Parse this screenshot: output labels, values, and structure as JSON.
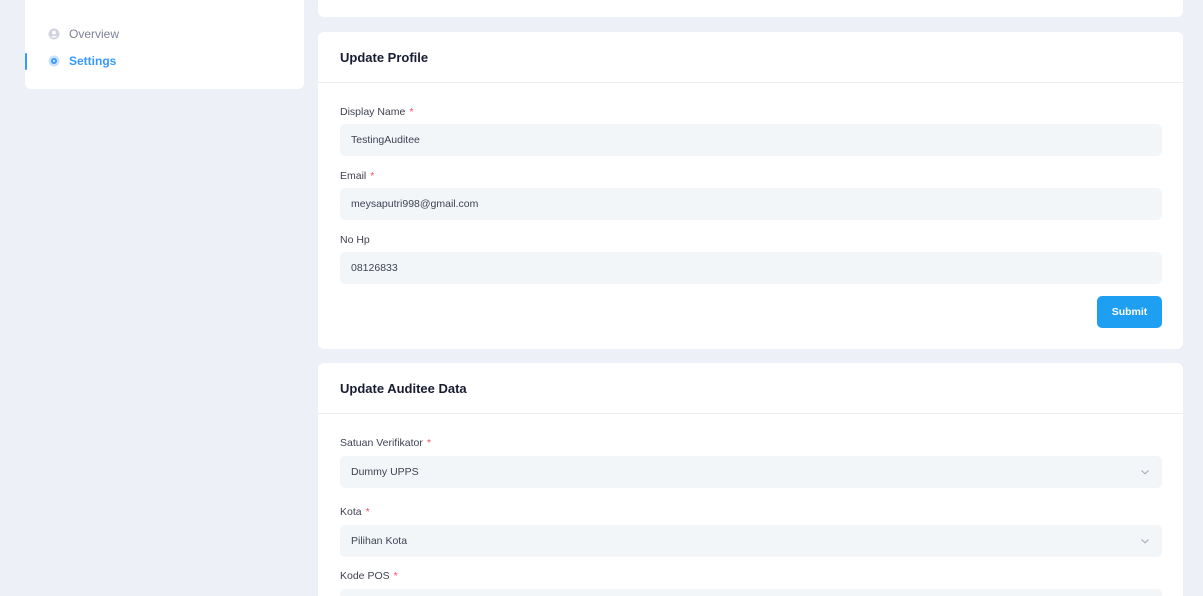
{
  "sidebar": {
    "items": [
      {
        "label": "Overview",
        "icon": "user-icon",
        "active": false
      },
      {
        "label": "Settings",
        "icon": "gear-icon",
        "active": true
      }
    ],
    "accent_color": "#3699ff"
  },
  "profile": {
    "title": "Update Profile",
    "display_name_label": "Display Name",
    "display_name_value": "TestingAuditee",
    "email_label": "Email",
    "email_value": "meysaputri998@gmail.com",
    "phone_label": "No Hp",
    "phone_value": "08126833",
    "submit_label": "Submit",
    "required_marker": "*"
  },
  "auditee": {
    "title": "Update Auditee Data",
    "verifikator_label": "Satuan Verifikator",
    "verifikator_value": "Dummy UPPS",
    "kota_label": "Kota",
    "kota_value": "Pilihan Kota",
    "kode_pos_label": "Kode POS",
    "required_marker": "*"
  }
}
